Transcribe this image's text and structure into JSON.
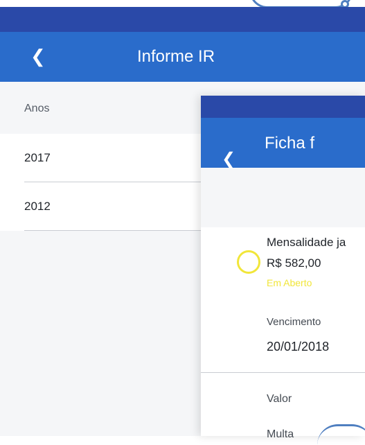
{
  "screen1": {
    "title": "Informe IR",
    "back_icon": "chevron-left-icon",
    "section_label": "Anos",
    "years": [
      "2017",
      "2012"
    ]
  },
  "screen2": {
    "title": "Ficha f",
    "back_icon": "chevron-left-icon",
    "item": {
      "description": "Mensalidade ja",
      "amount": "R$ 582,00",
      "status": "Em Aberto",
      "status_color": "#f1e63a",
      "due_label": "Vencimento",
      "due_date": "20/01/2018"
    },
    "fields": [
      "Valor",
      "Multa"
    ]
  },
  "colors": {
    "status_bar": "#2a49a8",
    "app_bar": "#2a6ccb",
    "accent_ring": "#f1e63a"
  }
}
